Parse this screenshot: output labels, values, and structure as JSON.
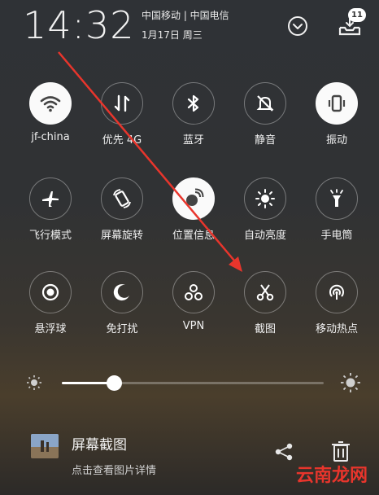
{
  "status": {
    "time": "14:32",
    "carrier": "中国移动 | 中国电信",
    "date": "1月17日 周三",
    "notification_count": "11"
  },
  "toggles": [
    {
      "label": "jf-china",
      "icon": "wifi-icon",
      "on": true
    },
    {
      "label": "优先 4G",
      "icon": "data-arrows-icon",
      "on": false
    },
    {
      "label": "蓝牙",
      "icon": "bluetooth-icon",
      "on": false
    },
    {
      "label": "静音",
      "icon": "bell-off-icon",
      "on": false
    },
    {
      "label": "振动",
      "icon": "vibrate-icon",
      "on": true
    },
    {
      "label": "飞行模式",
      "icon": "airplane-icon",
      "on": false
    },
    {
      "label": "屏幕旋转",
      "icon": "rotate-icon",
      "on": false
    },
    {
      "label": "位置信息",
      "icon": "location-icon",
      "on": true
    },
    {
      "label": "自动亮度",
      "icon": "sun-icon",
      "on": false
    },
    {
      "label": "手电筒",
      "icon": "flashlight-icon",
      "on": false
    },
    {
      "label": "悬浮球",
      "icon": "float-ball-icon",
      "on": false
    },
    {
      "label": "免打扰",
      "icon": "moon-icon",
      "on": false
    },
    {
      "label": "VPN",
      "icon": "vpn-icon",
      "on": false
    },
    {
      "label": "截图",
      "icon": "scissors-icon",
      "on": false
    },
    {
      "label": "移动热点",
      "icon": "hotspot-icon",
      "on": false
    }
  ],
  "brightness": {
    "level": 0.2
  },
  "notification": {
    "title": "屏幕截图",
    "subtitle": "点击查看图片详情"
  },
  "watermark": "云南龙网",
  "annotation_color": "#e8352c"
}
